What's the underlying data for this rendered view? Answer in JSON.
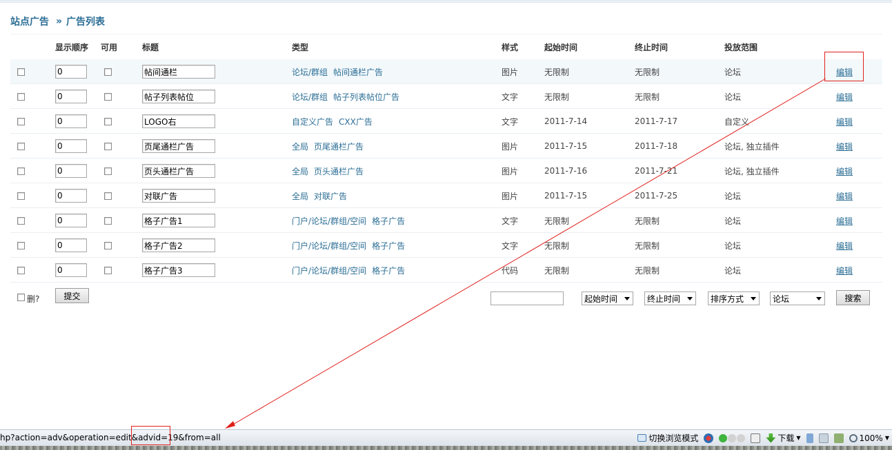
{
  "breadcrumb": {
    "root": "站点广告",
    "separator": "»",
    "current": "广告列表"
  },
  "table": {
    "headers": {
      "order": "显示顺序",
      "enabled": "可用",
      "title": "标题",
      "type": "类型",
      "style": "样式",
      "start": "起始时间",
      "end": "终止时间",
      "scope": "投放范围"
    },
    "rows": [
      {
        "order": "0",
        "title": "帖间通栏",
        "type_a": "论坛/群组",
        "type_b": "帖间通栏广告",
        "style": "图片",
        "start": "无限制",
        "end": "无限制",
        "scope": "论坛",
        "edit": "编辑"
      },
      {
        "order": "0",
        "title": "帖子列表帖位",
        "type_a": "论坛/群组",
        "type_b": "帖子列表帖位广告",
        "style": "文字",
        "start": "无限制",
        "end": "无限制",
        "scope": "论坛",
        "edit": "编辑"
      },
      {
        "order": "0",
        "title": "LOGO右",
        "type_a": "自定义广告",
        "type_b": "CXX广告",
        "style": "文字",
        "start": "2011-7-14",
        "end": "2011-7-17",
        "scope": "自定义",
        "edit": "编辑"
      },
      {
        "order": "0",
        "title": "页尾通栏广告",
        "type_a": "全局",
        "type_b": "页尾通栏广告",
        "style": "图片",
        "start": "2011-7-15",
        "end": "2011-7-18",
        "scope": "论坛, 独立插件",
        "edit": "编辑"
      },
      {
        "order": "0",
        "title": "页头通栏广告",
        "type_a": "全局",
        "type_b": "页头通栏广告",
        "style": "图片",
        "start": "2011-7-16",
        "end": "2011-7-21",
        "scope": "论坛, 独立插件",
        "edit": "编辑"
      },
      {
        "order": "0",
        "title": "对联广告",
        "type_a": "全局",
        "type_b": "对联广告",
        "style": "图片",
        "start": "2011-7-15",
        "end": "2011-7-25",
        "scope": "论坛",
        "edit": "编辑"
      },
      {
        "order": "0",
        "title": "格子广告1",
        "type_a": "门户/论坛/群组/空间",
        "type_b": "格子广告",
        "style": "文字",
        "start": "无限制",
        "end": "无限制",
        "scope": "论坛",
        "edit": "编辑"
      },
      {
        "order": "0",
        "title": "格子广告2",
        "type_a": "门户/论坛/群组/空间",
        "type_b": "格子广告",
        "style": "文字",
        "start": "无限制",
        "end": "无限制",
        "scope": "论坛",
        "edit": "编辑"
      },
      {
        "order": "0",
        "title": "格子广告3",
        "type_a": "门户/论坛/群组/空间",
        "type_b": "格子广告",
        "style": "代码",
        "start": "无限制",
        "end": "无限制",
        "scope": "论坛",
        "edit": "编辑"
      }
    ]
  },
  "footer": {
    "delete_label": "删?",
    "submit": "提交",
    "search_value": "",
    "start_select": "起始时间",
    "end_select": "终止时间",
    "sort_select": "排序方式",
    "scope_select": "论坛",
    "search_button": "搜索"
  },
  "statusbar": {
    "url": "hp?action=adv&operation=edit&advid=19&from=all",
    "browse_mode": "切换浏览模式",
    "download": "下载",
    "zoom": "100%"
  },
  "colors": {
    "link": "#2b6e95",
    "annotation": "#e0201c"
  }
}
